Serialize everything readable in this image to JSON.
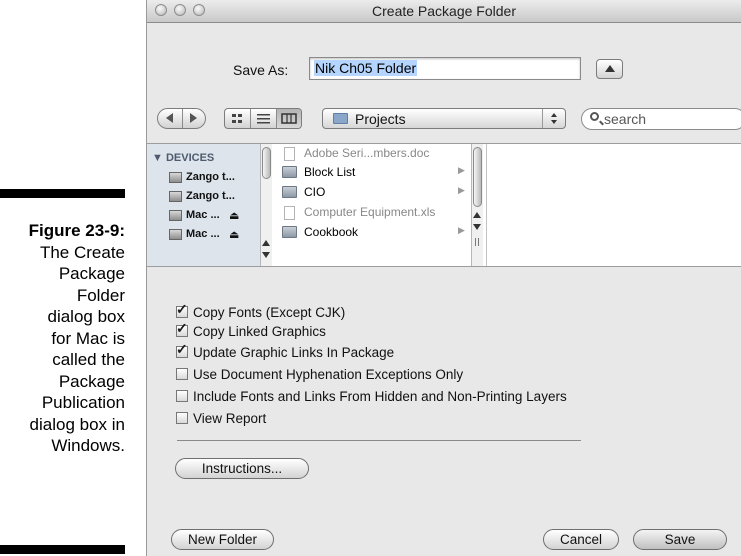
{
  "caption": {
    "figure": "Figure 23-9:",
    "lines": [
      "The Create",
      "Package",
      "Folder",
      "dialog box",
      "for Mac is",
      "called the",
      "Package",
      "Publication",
      "dialog box in",
      "Windows."
    ]
  },
  "window": {
    "title": "Create Package Folder"
  },
  "save_as": {
    "label": "Save As:",
    "value": "Nik Ch05 Folder"
  },
  "toolbar": {
    "location": "Projects",
    "search_placeholder": "search"
  },
  "sidebar": {
    "header": "DEVICES",
    "items": [
      {
        "label": "Zango t...",
        "eject": ""
      },
      {
        "label": "Zango t...",
        "eject": ""
      },
      {
        "label": "Mac ...",
        "eject": "⏏"
      },
      {
        "label": "Mac ...",
        "eject": "⏏"
      }
    ]
  },
  "files": [
    {
      "name": "Adobe Seri...mbers.doc",
      "kind": "doc",
      "dim": true,
      "arrow": ""
    },
    {
      "name": "Block List",
      "kind": "folder",
      "dim": false,
      "arrow": "▶"
    },
    {
      "name": "CIO",
      "kind": "folder",
      "dim": false,
      "arrow": "▶"
    },
    {
      "name": "Computer Equipment.xls",
      "kind": "doc",
      "dim": true,
      "arrow": ""
    },
    {
      "name": "Cookbook",
      "kind": "folder",
      "dim": false,
      "arrow": "▶"
    }
  ],
  "options": [
    {
      "label": "Copy Fonts (Except CJK)",
      "checked": true
    },
    {
      "label": "Copy Linked Graphics",
      "checked": true
    },
    {
      "label": "Update Graphic Links In Package",
      "checked": true
    },
    {
      "label": "Use Document Hyphenation Exceptions Only",
      "checked": false
    },
    {
      "label": "Include Fonts and Links From Hidden and Non-Printing Layers",
      "checked": false
    },
    {
      "label": "View Report",
      "checked": false
    }
  ],
  "buttons": {
    "instructions": "Instructions...",
    "new_folder": "New Folder",
    "cancel": "Cancel",
    "save": "Save"
  }
}
